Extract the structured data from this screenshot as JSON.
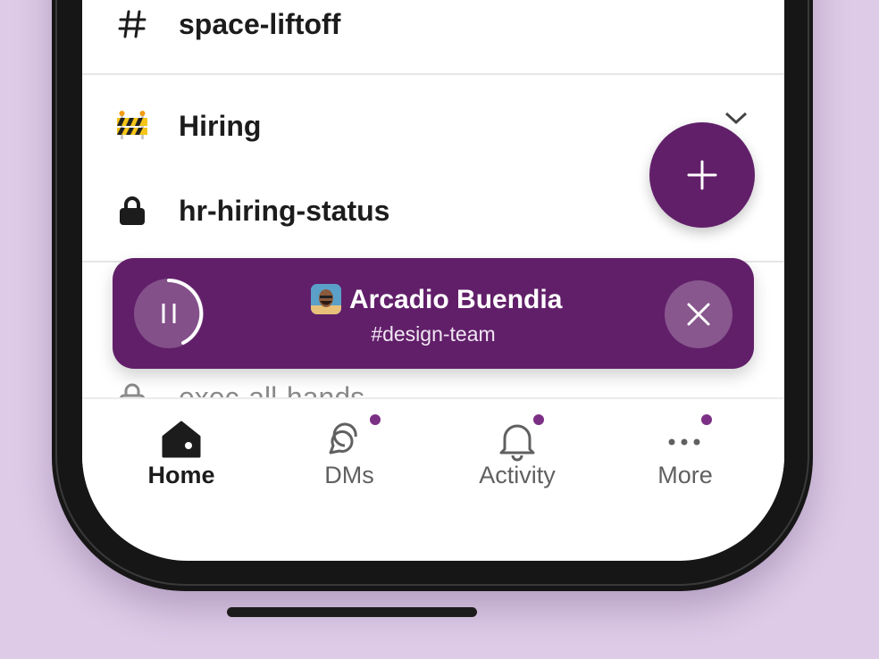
{
  "channels": {
    "space_liftoff": "space-liftoff",
    "section_hiring": "Hiring",
    "hr_hiring_status": "hr-hiring-status",
    "exec_all_hands": "exec-all-hands"
  },
  "huddle": {
    "name": "Arcadio Buendia",
    "channel": "#design-team"
  },
  "tabs": [
    {
      "label": "Home",
      "icon": "home-icon",
      "active": true
    },
    {
      "label": "DMs",
      "icon": "dms-icon",
      "badge": true
    },
    {
      "label": "Activity",
      "icon": "bell-icon",
      "badge": true
    },
    {
      "label": "More",
      "icon": "more-icon",
      "badge": true
    }
  ],
  "colors": {
    "accent": "#611f69",
    "background": "#decbe8",
    "badge": "#7c3085"
  }
}
